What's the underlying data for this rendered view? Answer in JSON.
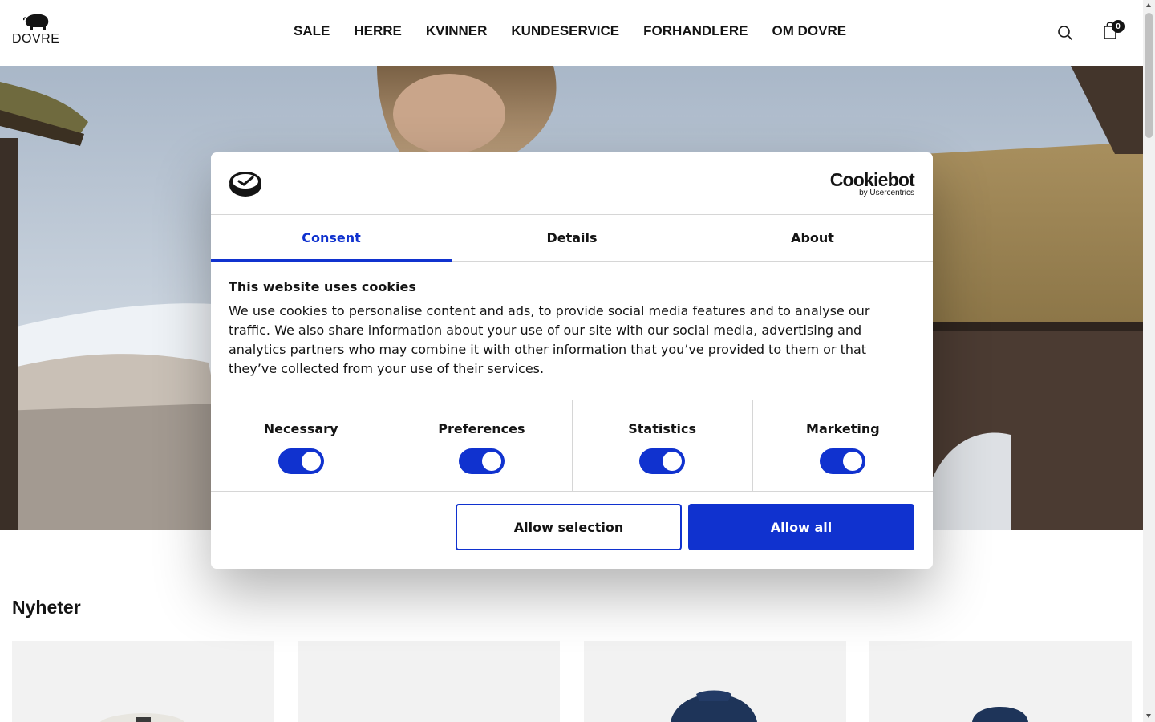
{
  "header": {
    "logo_text": "DOVRE",
    "nav": [
      "SALE",
      "HERRE",
      "KVINNER",
      "KUNDESERVICE",
      "FORHANDLERE",
      "OM DOVRE"
    ],
    "cart_count": "0",
    "icons": {
      "search": "search-icon",
      "cart": "shopping-bag-icon"
    }
  },
  "main": {
    "section_title": "Nyheter",
    "products": [
      "light-sweater",
      "empty",
      "navy-jacket",
      "navy-jacket-hooded"
    ]
  },
  "cookie_dialog": {
    "brand": {
      "name": "Cookiebot",
      "sub": "by Usercentrics"
    },
    "tabs": [
      "Consent",
      "Details",
      "About"
    ],
    "active_tab": "Consent",
    "title": "This website uses cookies",
    "text": "We use cookies to personalise content and ads, to provide social media features and to analyse our traffic. We also share information about your use of our site with our social media, advertising and analytics partners who may combine it with other information that you’ve provided to them or that they’ve collected from your use of their services.",
    "toggles": [
      {
        "label": "Necessary",
        "on": true
      },
      {
        "label": "Preferences",
        "on": true
      },
      {
        "label": "Statistics",
        "on": true
      },
      {
        "label": "Marketing",
        "on": true
      }
    ],
    "buttons": {
      "selection": "Allow selection",
      "all": "Allow all"
    }
  },
  "colors": {
    "accent": "#1032cf",
    "text": "#141414",
    "divider": "#d6d6d6",
    "card_bg": "#f2f2f2"
  }
}
